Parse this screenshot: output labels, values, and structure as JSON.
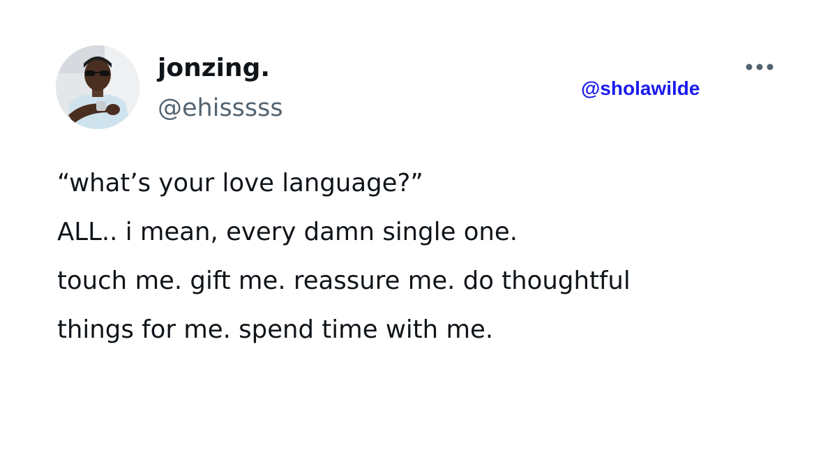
{
  "author": {
    "display_name": "jonzing.",
    "handle": "@ehisssss",
    "avatar_icon": "profile-photo"
  },
  "watermark": "@sholawilde",
  "more_icon": "more-horizontal-icon",
  "tweet": {
    "lines": [
      "“what’s your love language?”",
      "ALL.. i mean, every damn single one.",
      "touch me. gift me. reassure me. do thoughtful",
      "things for me. spend time with me."
    ]
  },
  "colors": {
    "text": "#0f1419",
    "handle": "#536471",
    "watermark": "#1a1aee",
    "background": "#ffffff"
  }
}
